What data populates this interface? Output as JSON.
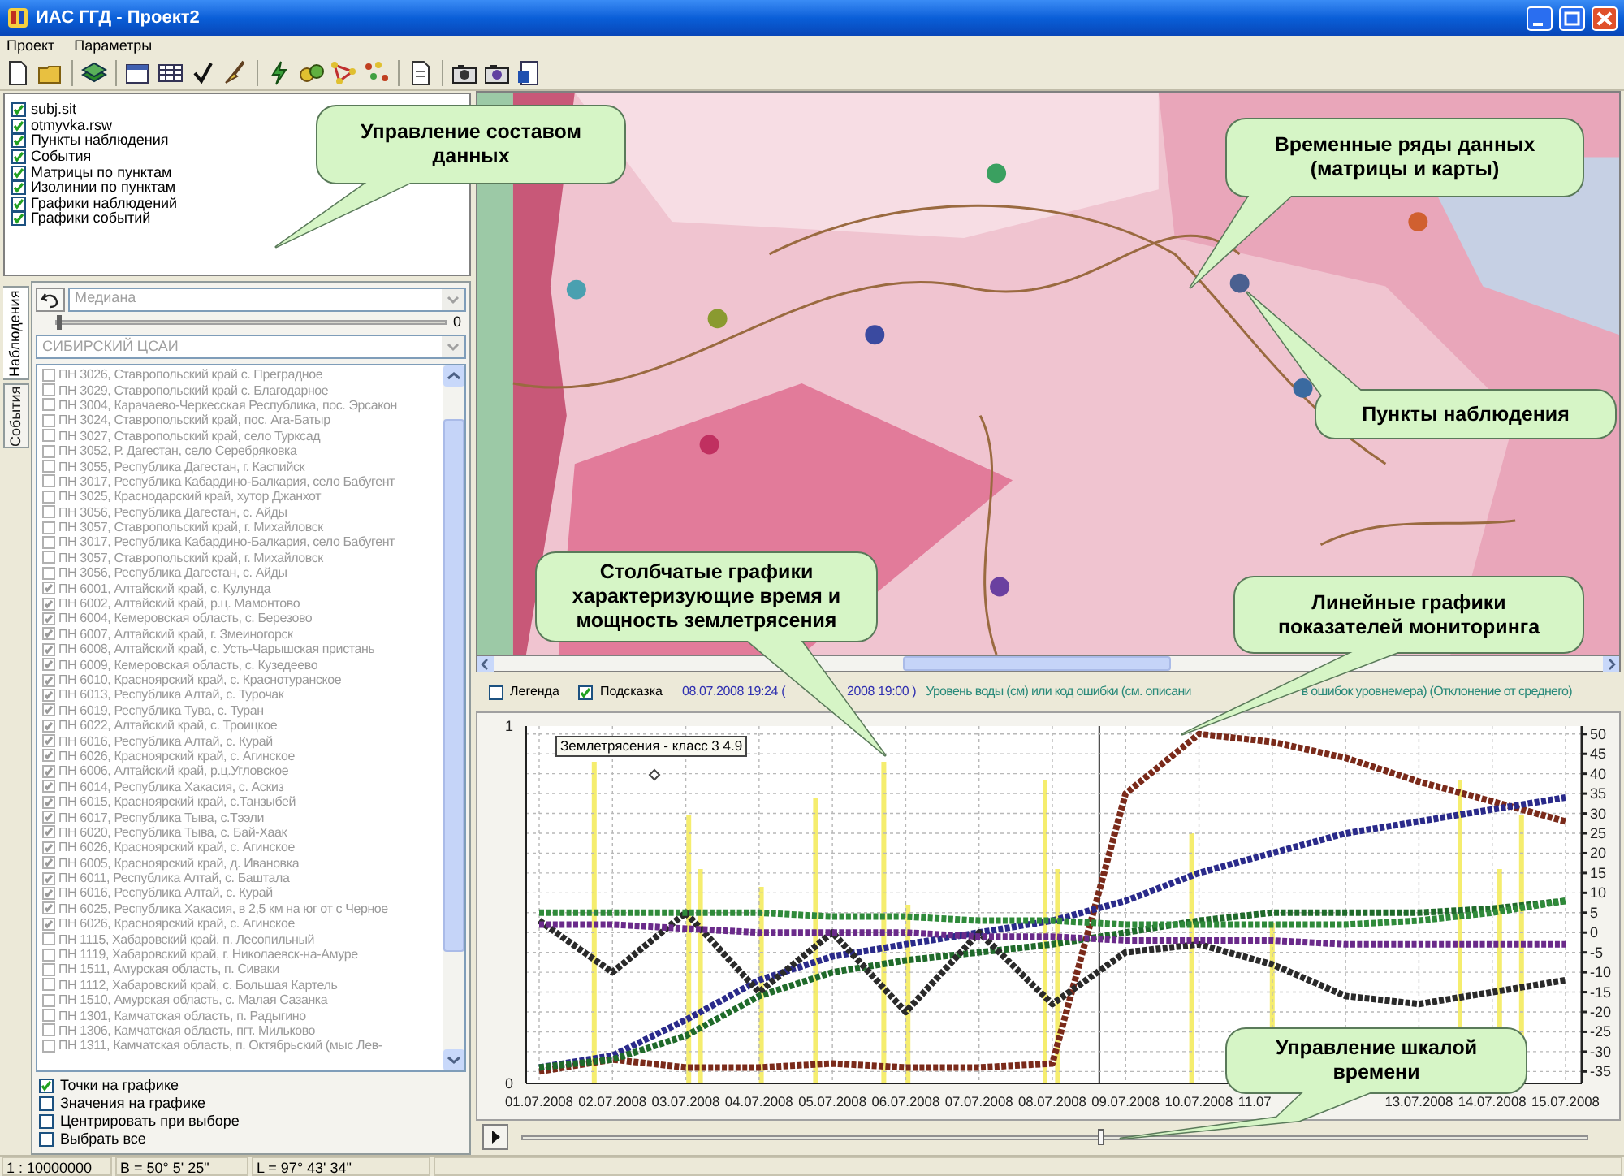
{
  "window": {
    "title": "ИАС ГГД - Проект2"
  },
  "menu": [
    "Проект",
    "Параметры"
  ],
  "layers": [
    {
      "label": "subj.sit",
      "checked": true
    },
    {
      "label": "otmyvka.rsw",
      "checked": true
    },
    {
      "label": "Пункты наблюдения",
      "checked": true
    },
    {
      "label": "События",
      "checked": true
    },
    {
      "label": "Матрицы по пунктам",
      "checked": true
    },
    {
      "label": "Изолинии по пунктам",
      "checked": true
    },
    {
      "label": "Графики наблюдений",
      "checked": true
    },
    {
      "label": "Графики событий",
      "checked": true
    }
  ],
  "side_tabs": [
    {
      "label": "Наблюдения",
      "selected": true
    },
    {
      "label": "События",
      "selected": false
    }
  ],
  "statistic_combo": {
    "value": "Медиана",
    "disabled": true
  },
  "statistic_slider": {
    "level": 0,
    "reading": "0"
  },
  "region_combo": {
    "value": "СИБИРСКИЙ ЦСАИ",
    "disabled": true
  },
  "stations": [
    {
      "label": "ПН 3026, Ставропольский край с. Преградное",
      "checked": false
    },
    {
      "label": "ПН 3029, Ставропольский край с. Благодарное",
      "checked": false
    },
    {
      "label": "ПН 3004, Карачаево-Черкесская Республика, пос. Эрсакон",
      "checked": false
    },
    {
      "label": "ПН 3024, Ставропольский край, пос. Ага-Батыр",
      "checked": false
    },
    {
      "label": "ПН 3027, Ставропольский край, село Турксад",
      "checked": false
    },
    {
      "label": "ПН 3052, Р. Дагестан, село Серебряковка",
      "checked": false
    },
    {
      "label": "ПН 3055, Республика Дагестан, г. Каспийск",
      "checked": false
    },
    {
      "label": "ПН 3017, Республика Кабардино-Балкария, село Бабугент",
      "checked": false
    },
    {
      "label": "ПН 3025, Краснодарский край, хутор Джанхот",
      "checked": false
    },
    {
      "label": "ПН 3056, Республика Дагестан, с. Айды",
      "checked": false
    },
    {
      "label": "ПН 3057, Ставропольский край, г. Михайловск",
      "checked": false
    },
    {
      "label": "ПН 3017, Республика Кабардино-Балкария, село Бабугент",
      "checked": false
    },
    {
      "label": "ПН 3057, Ставропольский край, г. Михайловск",
      "checked": false
    },
    {
      "label": "ПН 3056, Республика Дагестан, с. Айды",
      "checked": false
    },
    {
      "label": "ПН 6001, Алтайский край, с. Кулунда",
      "checked": true
    },
    {
      "label": "ПН 6002, Алтайский край, р.ц. Мамонтово",
      "checked": true
    },
    {
      "label": "ПН 6004, Кемеровская область, с. Березово",
      "checked": true
    },
    {
      "label": "ПН 6007, Алтайский край, г. Змеиногорск",
      "checked": true
    },
    {
      "label": "ПН 6008, Алтайский край, с. Усть-Чарышская пристань",
      "checked": true
    },
    {
      "label": "ПН 6009, Кемеровская область, с. Кузедеево",
      "checked": true
    },
    {
      "label": "ПН 6010, Красноярский край, с. Краснотуранское",
      "checked": true
    },
    {
      "label": "ПН 6013, Республика Алтай, с. Турочак",
      "checked": true
    },
    {
      "label": "ПН 6019, Республика Тува, с. Туран",
      "checked": true
    },
    {
      "label": "ПН 6022, Алтайский край, с. Троицкое",
      "checked": true
    },
    {
      "label": "ПН 6016, Республика Алтай, с. Курай",
      "checked": true
    },
    {
      "label": "ПН 6026, Красноярский край, с. Агинское",
      "checked": true
    },
    {
      "label": "ПН 6006, Алтайский край, р.ц.Угловское",
      "checked": true
    },
    {
      "label": "ПН 6014, Республика Хакасия, с. Аскиз",
      "checked": true
    },
    {
      "label": "ПН 6015, Красноярский край, с.Танзыбей",
      "checked": true
    },
    {
      "label": "ПН 6017, Республика Тыва, с.Тээли",
      "checked": true
    },
    {
      "label": "ПН 6020, Республика Тыва, с. Бай-Хаак",
      "checked": true
    },
    {
      "label": "ПН 6026, Красноярский край, с. Агинское",
      "checked": true
    },
    {
      "label": "ПН 6005, Красноярский край, д. Ивановка",
      "checked": true
    },
    {
      "label": "ПН 6011, Республика Алтай, с. Баштала",
      "checked": true
    },
    {
      "label": "ПН 6016, Республика Алтай, с. Курай",
      "checked": true
    },
    {
      "label": "ПН 6025, Республика Хакасия, в 2,5 км на юг от с Черное",
      "checked": true
    },
    {
      "label": "ПН 6026, Красноярский край, с. Агинское",
      "checked": true
    },
    {
      "label": "ПН 1115, Хабаровский край, п. Лесопильный",
      "checked": false
    },
    {
      "label": "ПН 1119, Хабаровский край, г. Николаевск-на-Амуре",
      "checked": false
    },
    {
      "label": "ПН 1511, Амурская область, п. Сиваки",
      "checked": false
    },
    {
      "label": "ПН 1112, Хабаровский край, с. Большая Картель",
      "checked": false
    },
    {
      "label": "ПН 1510, Амурская область, с. Малая Сазанка",
      "checked": false
    },
    {
      "label": "ПН 1301, Камчатская область, п. Радыгино",
      "checked": false
    },
    {
      "label": "ПН 1306, Камчатская область, пгт. Мильково",
      "checked": false
    },
    {
      "label": "ПН 1311, Камчатская область, п. Октябрьский (мыс Лев-",
      "checked": false
    }
  ],
  "options": [
    {
      "label": "Точки на графике",
      "checked": true
    },
    {
      "label": "Значения на графике",
      "checked": false
    },
    {
      "label": "Центрировать при выборе",
      "checked": false
    },
    {
      "label": "Выбрать все",
      "checked": false
    }
  ],
  "chart_options": [
    {
      "label": "Легенда",
      "checked": false
    },
    {
      "label": "Подсказка",
      "checked": true
    }
  ],
  "hint": {
    "time_parts": [
      "08.07.2008 19:24 (",
      "2008 19:00 )"
    ],
    "parameter_parts": [
      "Уровень воды (см) или код ошибки (см. описани",
      "в ошибок уровнемера) (Отклонение от среднего)"
    ]
  },
  "chart": {
    "left_axis_labels": [
      "1",
      "0"
    ],
    "tooltip": "Землетрясения - класс 3 4.9",
    "chart_data": {
      "type": "line",
      "categories": [
        "01.07.2008",
        "02.07.2008",
        "03.07.2008",
        "04.07.2008",
        "05.07.2008",
        "06.07.2008",
        "07.07.2008",
        "08.07.2008",
        "09.07.2008",
        "10.07.2008",
        "11.07",
        null,
        "13.07.2008",
        "14.07.2008",
        "15.07.2008"
      ],
      "grid": true,
      "yticks": [
        -35,
        -30,
        -25,
        -20,
        -15,
        -10,
        -5,
        0,
        5,
        10,
        15,
        20,
        25,
        30,
        35,
        40,
        45,
        50
      ],
      "ylim": [
        -38,
        52
      ],
      "series": [
        {
          "color": "#7a2a1a",
          "line_style": "dotted",
          "values": [
            -35,
            -32,
            -34,
            -34,
            -33,
            -34,
            -34,
            -33,
            35,
            50,
            48,
            44,
            38,
            33,
            28
          ]
        },
        {
          "color": "#2a2a8a",
          "line_style": "dotted",
          "values": [
            -34,
            -31,
            -22,
            -12,
            -6,
            -3,
            0,
            3,
            8,
            15,
            20,
            25,
            28,
            31,
            34
          ]
        },
        {
          "color": "#1f6a2a",
          "line_style": "dotted",
          "values": [
            -34,
            -32,
            -26,
            -16,
            -10,
            -7,
            -5,
            -3,
            0,
            3,
            5,
            5,
            5,
            6,
            8
          ]
        },
        {
          "color": "#2a2a2a",
          "line_style": "dotted",
          "values": [
            3,
            -10,
            5,
            -15,
            0,
            -20,
            0,
            -18,
            -5,
            -3,
            -8,
            -16,
            -18,
            -15,
            -12
          ]
        },
        {
          "color": "#6a2a8a",
          "line_style": "dotted",
          "values": [
            2,
            2,
            1,
            0,
            0,
            0,
            -1,
            -1,
            -2,
            -2,
            -2,
            -3,
            -3,
            -3,
            -3
          ]
        },
        {
          "color": "#2f8a3a",
          "line_style": "dotted",
          "values": [
            5,
            5,
            5,
            5,
            4,
            4,
            3,
            3,
            2,
            2,
            2,
            2,
            3,
            5,
            8
          ]
        }
      ]
    }
  },
  "time_slider": {
    "level": 0.54
  },
  "status_bar": [
    "1 : 10000000",
    "B = 50° 5' 25\"",
    "L = 97° 43' 34\""
  ],
  "callouts": [
    "Управление составом данных",
    "Временные ряды данных (матрицы и карты)",
    "Пункты наблюдения",
    "Столбчатые графики характеризующие время и мощность землетрясения",
    "Линейные графики показателей мониторинга",
    "Управление шкалой времени"
  ]
}
